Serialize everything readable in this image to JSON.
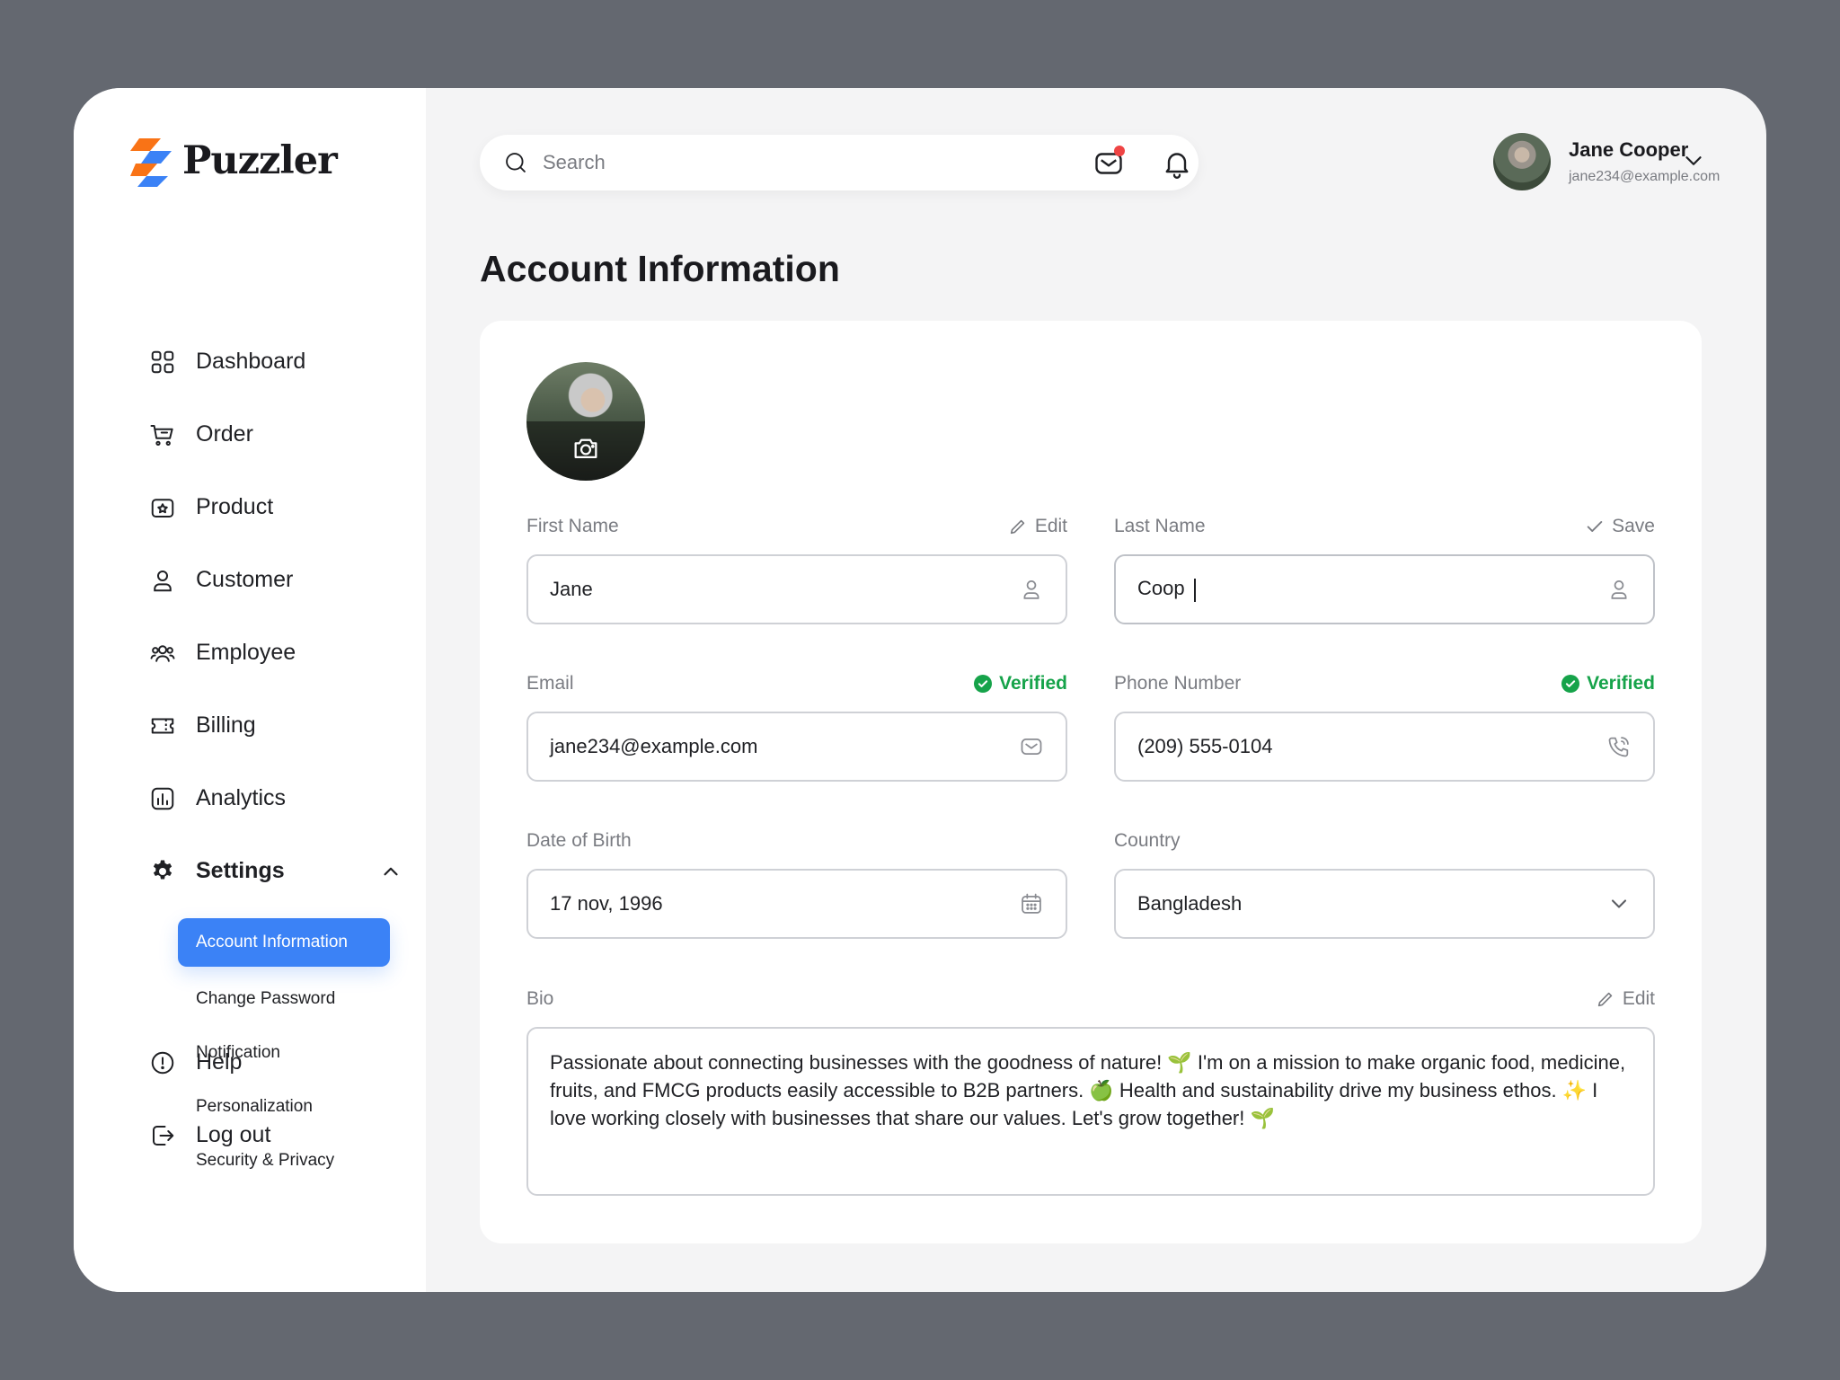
{
  "brand": {
    "name": "Puzzler"
  },
  "sidebar": {
    "items": [
      {
        "label": "Dashboard",
        "icon": "grid-icon"
      },
      {
        "label": "Order",
        "icon": "cart-icon"
      },
      {
        "label": "Product",
        "icon": "product-icon"
      },
      {
        "label": "Customer",
        "icon": "user-icon"
      },
      {
        "label": "Employee",
        "icon": "users-icon"
      },
      {
        "label": "Billing",
        "icon": "ticket-icon"
      },
      {
        "label": "Analytics",
        "icon": "chart-icon"
      }
    ],
    "settings": {
      "label": "Settings",
      "expanded": true,
      "sub_items": [
        {
          "label": "Account Information",
          "active": true
        },
        {
          "label": "Change Password",
          "active": false
        },
        {
          "label": "Notification",
          "active": false
        },
        {
          "label": "Personalization",
          "active": false
        },
        {
          "label": "Security & Privacy",
          "active": false
        }
      ]
    },
    "bottom": [
      {
        "label": "Help",
        "icon": "help-icon"
      },
      {
        "label": "Log out",
        "icon": "logout-icon"
      }
    ]
  },
  "header": {
    "search_placeholder": "Search",
    "user": {
      "name": "Jane Cooper",
      "email": "jane234@example.com"
    },
    "mail_has_notification": true
  },
  "page": {
    "title": "Account Information"
  },
  "form": {
    "first_name": {
      "label": "First Name",
      "value": "Jane",
      "action": "Edit"
    },
    "last_name": {
      "label": "Last Name",
      "value": "Coop",
      "action": "Save"
    },
    "email": {
      "label": "Email",
      "value": "jane234@example.com",
      "status": "Verified"
    },
    "phone": {
      "label": "Phone Number",
      "value": "(209) 555-0104",
      "status": "Verified"
    },
    "dob": {
      "label": "Date of Birth",
      "value": "17 nov, 1996"
    },
    "country": {
      "label": "Country",
      "value": "Bangladesh"
    },
    "bio": {
      "label": "Bio",
      "action": "Edit",
      "value": "Passionate about connecting businesses with the goodness of nature! 🌱 I'm on a mission to make organic food, medicine, fruits, and FMCG products easily accessible to B2B partners. 🍏 Health and sustainability drive my business ethos. ✨ I love working closely with businesses that share our values. Let's grow together! 🌱"
    }
  },
  "colors": {
    "accent": "#3b82f6",
    "verified": "#16a34a",
    "notification_dot": "#ef4444",
    "background": "#646870"
  }
}
